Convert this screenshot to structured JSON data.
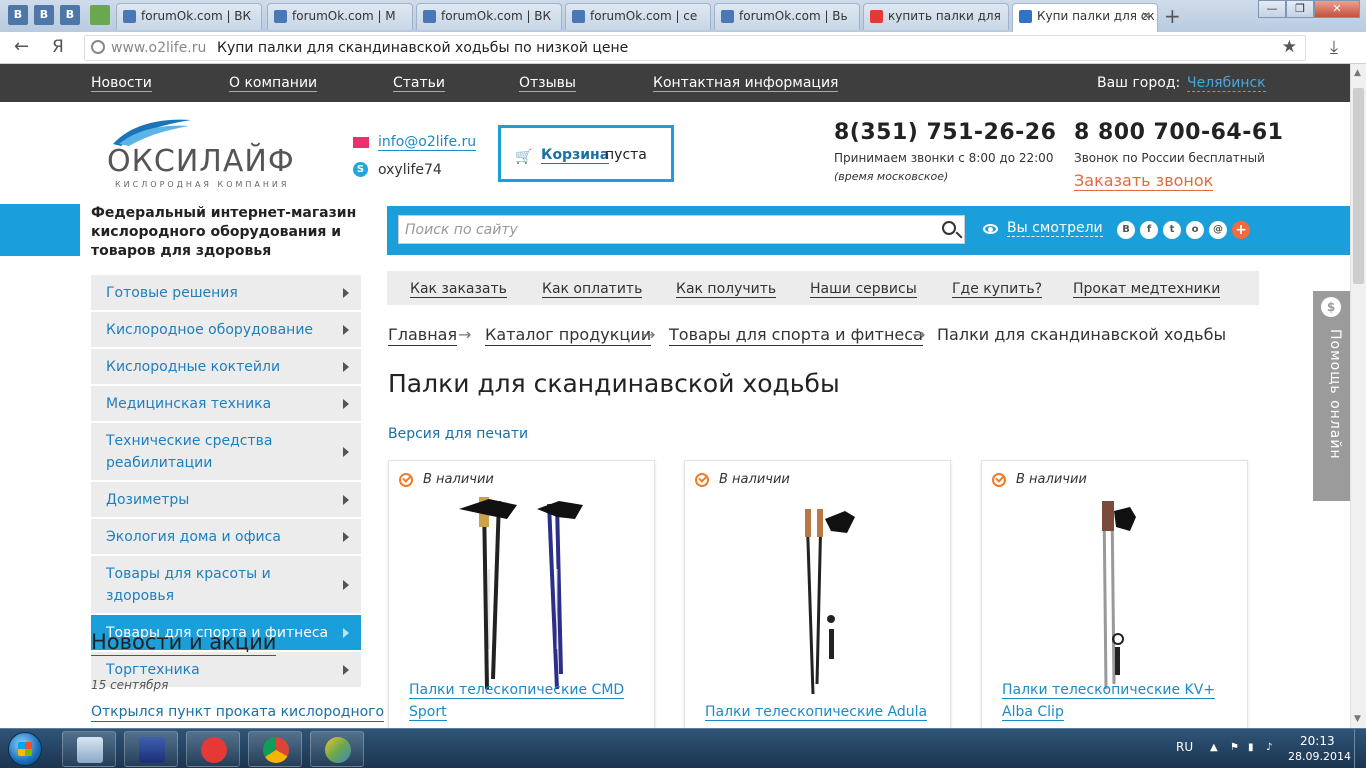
{
  "browser": {
    "pinned_tabs": [
      "B",
      "B",
      "B"
    ],
    "tabs": [
      {
        "label": "forumOk.com | ВК"
      },
      {
        "label": "forumOk.com | М"
      },
      {
        "label": "forumOk.com | ВК"
      },
      {
        "label": "forumOk.com | се"
      },
      {
        "label": "forumOk.com | Вь"
      },
      {
        "label": "купить палки для"
      },
      {
        "label": "Купи палки для ск"
      }
    ],
    "address": {
      "domain": "www.o2life.ru",
      "title": "Купи палки для скандинавской ходьбы по низкой цене"
    },
    "yandex_button": "Я"
  },
  "topnav": {
    "items": [
      "Новости",
      "О компании",
      "Статьи",
      "Отзывы",
      "Контактная информация"
    ],
    "city_label": "Ваш город:",
    "city": "Челябинск"
  },
  "header": {
    "logo_name": "ОКСИЛАЙФ",
    "logo_sub": "КИСЛОРОДНАЯ КОМПАНИЯ",
    "email": "info@o2life.ru",
    "skype": "oxylife74",
    "cart_label": "Корзина",
    "cart_state": "пуста",
    "phone1": "8(351) 751-26-26",
    "phone1_note": "Принимаем звонки с 8:00 до 22:00",
    "phone1_note2": "(время московское)",
    "phone2": "8 800 700-64-61",
    "phone2_note": "Звонок по России бесплатный",
    "callback": "Заказать звонок",
    "tagline": "Федеральный интернет-магазин кислородного оборудования и товаров для здоровья"
  },
  "search": {
    "placeholder": "Поиск по сайту"
  },
  "viewed": "Вы смотрели",
  "social": [
    "В",
    "f",
    "t",
    "о",
    "@",
    "+"
  ],
  "sidebar": {
    "items": [
      {
        "label": "Готовые решения"
      },
      {
        "label": "Кислородное оборудование"
      },
      {
        "label": "Кислородные коктейли"
      },
      {
        "label": "Медицинская техника"
      },
      {
        "label": "Технические средства реабилитации"
      },
      {
        "label": "Дозиметры"
      },
      {
        "label": "Экология дома и офиса"
      },
      {
        "label": "Товары для красоты и здоровья"
      },
      {
        "label": "Товары для спорта и фитнеса"
      },
      {
        "label": "Торгтехника"
      }
    ],
    "active_index": 8
  },
  "news": {
    "title": "Новости и акции",
    "date": "15 сентября",
    "link": "Открылся пункт проката кислородного"
  },
  "infomenu": [
    "Как заказать",
    "Как оплатить",
    "Как получить",
    "Наши сервисы",
    "Где купить?",
    "Прокат медтехники"
  ],
  "breadcrumb": [
    "Главная",
    "Каталог продукции",
    "Товары для спорта и фитнеса",
    "Палки для скандинавской ходьбы"
  ],
  "breadcrumb_sep": "→",
  "page_title": "Палки для скандинавской ходьбы",
  "print_version": "Версия для печати",
  "products": [
    {
      "availability": "В наличии",
      "name": "Палки телескопические CMD Sport"
    },
    {
      "availability": "В наличии",
      "name": "Палки телескопические Adula"
    },
    {
      "availability": "В наличии",
      "name": "Палки телескопические KV+ Alba Clip"
    }
  ],
  "help_tab": "Помощь онлайн",
  "taskbar": {
    "lang": "RU",
    "time": "20:13",
    "date": "28.09.2014"
  },
  "colors": {
    "accent": "#1b9fdb",
    "dark_nav": "#3e3e3e",
    "link": "#1b8ac8",
    "callback": "#e26a3b",
    "available": "#f07c29"
  }
}
